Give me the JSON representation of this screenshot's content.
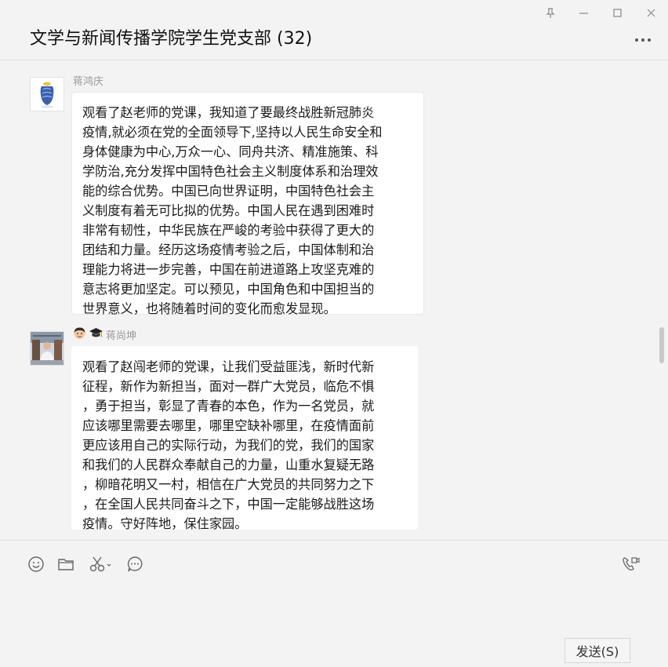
{
  "window": {
    "controls": [
      "pin-icon",
      "minimize-icon",
      "maximize-icon",
      "close-icon"
    ]
  },
  "header": {
    "title": "文学与新闻传播学院学生党支部 (32)"
  },
  "messages": [
    {
      "sender": "蒋鸿庆",
      "avatar": "avatar-blue-jar",
      "lines": [
        "观看了赵老师的党课，我知道了要最终战胜新冠肺炎",
        "疫情,就必须在党的全面领导下,坚持以人民生命安全和",
        "身体健康为中心,万众一心、同舟共济、精准施策、科",
        "学防治,充分发挥中国特色社会主义制度体系和治理效",
        "能的综合优势。中国已向世界证明，中国特色社会主",
        "义制度有着无可比拟的优势。中国人民在遇到困难时",
        "非常有韧性，中华民族在严峻的考验中获得了更大的",
        "团结和力量。经历这场疫情考验之后，中国体制和治",
        "理能力将进一步完善，中国在前进道路上攻坚克难的",
        "意志将更加坚定。可以预见，中国角色和中国担当的",
        "世界意义，也将随着时间的变化而愈发显现。"
      ]
    },
    {
      "sender": "蒋尚坤",
      "sender_emojis": [
        "man-face-icon",
        "graduation-cap-icon"
      ],
      "avatar": "avatar-photo",
      "lines": [
        "观看了赵闯老师的党课，让我们受益匪浅，新时代新",
        "征程，新作为新担当，面对一群广大党员，临危不惧",
        "，勇于担当，彰显了青春的本色，作为一名党员，就",
        "应该哪里需要去哪里，哪里空缺补哪里，在疫情面前",
        "更应该用自己的实际行动，为我们的党，我们的国家",
        "和我们的人民群众奉献自己的力量，山重水复疑无路",
        "，柳暗花明又一村，相信在广大党员的共同努力之下",
        "，在全国人民共同奋斗之下，中国一定能够战胜这场",
        "疫情。守好阵地，保住家园。"
      ]
    }
  ],
  "toolbar": {
    "icons": [
      "emoji-icon",
      "folder-icon",
      "scissors-icon",
      "chat-history-icon",
      "video-call-icon"
    ]
  },
  "input": {
    "value": ""
  },
  "send_button": {
    "label": "发送(S)"
  }
}
